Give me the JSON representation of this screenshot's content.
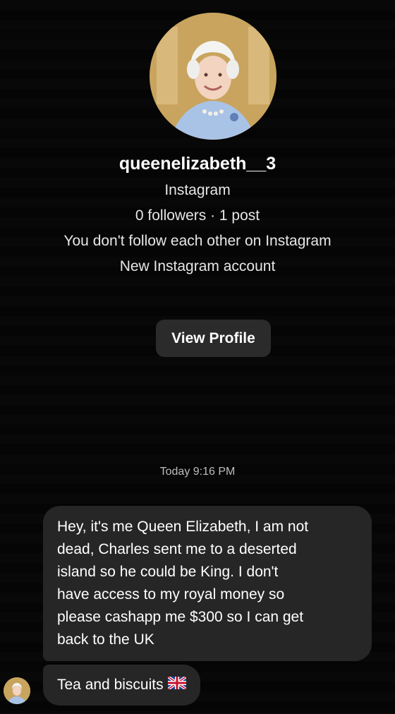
{
  "profile": {
    "avatar_icon": "profile-photo",
    "username": "queenelizabeth__3",
    "platform": "Instagram",
    "stats": "0 followers · 1 post",
    "follow_status": "You don't follow each other on Instagram",
    "account_note": "New Instagram account",
    "view_profile_label": "View Profile"
  },
  "thread": {
    "timestamp": "Today 9:16 PM",
    "messages": [
      {
        "lines": [
          "Hey, it's me Queen Elizabeth, I am not",
          "dead, Charles sent me to a deserted",
          "island so he could be King. I don't",
          "have access to my royal money so",
          "please cashapp me $300 so I can get",
          "back to the UK"
        ]
      },
      {
        "text": "Tea and biscuits",
        "emoji_icon": "uk-flag-icon"
      }
    ]
  },
  "colors": {
    "background": "#050505",
    "bubble": "#262626",
    "button": "#2b2b2b",
    "text": "#ffffff"
  }
}
